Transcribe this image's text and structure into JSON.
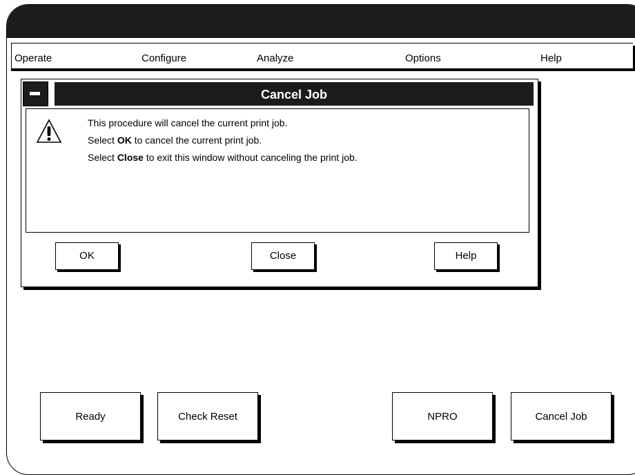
{
  "menubar": {
    "items": [
      {
        "label": "Operate"
      },
      {
        "label": "Configure"
      },
      {
        "label": "Analyze"
      },
      {
        "label": "Options"
      },
      {
        "label": "Help"
      }
    ]
  },
  "dialog": {
    "title": "Cancel Job",
    "message": {
      "line1": "This procedure will cancel the current print job.",
      "line2_prefix": "Select ",
      "line2_bold": "OK",
      "line2_suffix": " to cancel the current print job.",
      "line3_prefix": "Select ",
      "line3_bold": "Close",
      "line3_suffix": " to exit this window without canceling the print job."
    },
    "buttons": {
      "ok": "OK",
      "close": "Close",
      "help": "Help"
    }
  },
  "bottom_buttons": {
    "ready": "Ready",
    "check_reset": "Check Reset",
    "npro": "NPRO",
    "cancel_job": "Cancel Job"
  },
  "icons": {
    "warning": "warning-triangle-icon",
    "system_menu": "minus-icon"
  }
}
